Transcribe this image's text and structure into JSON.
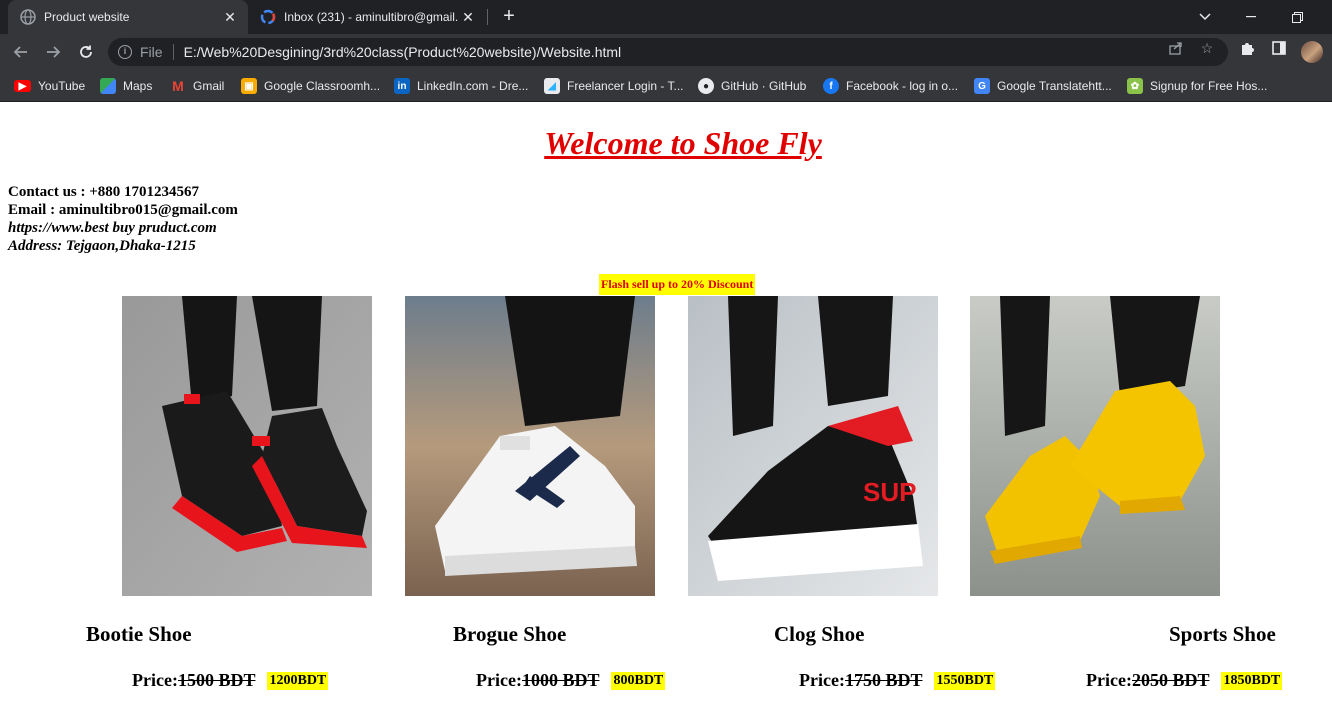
{
  "browser": {
    "tabs": [
      {
        "title": "Product website",
        "favicon": "globe-icon",
        "active": true
      },
      {
        "title": "Inbox (231) - aminultibro@gmail.",
        "favicon": "gmail-icon",
        "active": false
      }
    ],
    "address_scheme": "File",
    "address_url": "E:/Web%20Desgining/3rd%20class(Product%20website)/Website.html",
    "bookmarks": [
      {
        "label": "YouTube",
        "icon": "youtube-icon",
        "color": "#ff0000"
      },
      {
        "label": "Maps",
        "icon": "maps-icon",
        "color": "#34a853"
      },
      {
        "label": "Gmail",
        "icon": "gmail-icon",
        "color": "#ea4335"
      },
      {
        "label": "Google Classroomh...",
        "icon": "classroom-icon",
        "color": "#f9ab00"
      },
      {
        "label": "LinkedIn.com - Dre...",
        "icon": "linkedin-icon",
        "color": "#0a66c2"
      },
      {
        "label": "Freelancer Login - T...",
        "icon": "freelancer-icon",
        "color": "#29b2fe"
      },
      {
        "label": "GitHub · GitHub",
        "icon": "github-icon",
        "color": "#ffffff"
      },
      {
        "label": "Facebook - log in o...",
        "icon": "facebook-icon",
        "color": "#1877f2"
      },
      {
        "label": "Google Translatehtt...",
        "icon": "translate-icon",
        "color": "#4285f4"
      },
      {
        "label": "Signup for Free Hos...",
        "icon": "hosting-icon",
        "color": "#8bc34a"
      }
    ]
  },
  "site": {
    "heading": "Welcome to Shoe Fly",
    "contact": "Contact us : +880 1701234567",
    "email": "Email : aminultibro015@gmail.com",
    "website": "https://www.best buy pruduct.com",
    "address": "Address: Tejgaon,Dhaka-1215",
    "flash": "Flash sell up to 20% Discount",
    "price_label": "Price:",
    "products": [
      {
        "name": "Bootie Shoe",
        "old_price": "1500 BDT",
        "new_price": "1200BDT",
        "shoe_color": "#1a1a1a",
        "accent": "#e8141c",
        "bg": "#9e9e9e"
      },
      {
        "name": "Brogue Shoe",
        "old_price": "1000 BDT",
        "new_price": "800BDT",
        "shoe_color": "#f5f5f5",
        "accent": "#1b2a4a",
        "bg": "#b79b86"
      },
      {
        "name": "Clog Shoe",
        "old_price": "1750 BDT",
        "new_price": "1550BDT",
        "shoe_color": "#151515",
        "accent": "#e31b23",
        "bg": "#cfd3d6"
      },
      {
        "name": "Sports Shoe",
        "old_price": "2050 BDT",
        "new_price": "1850BDT",
        "shoe_color": "#f2c200",
        "accent": "#e0a800",
        "bg": "#9aa39a"
      }
    ]
  }
}
